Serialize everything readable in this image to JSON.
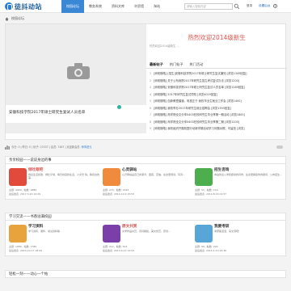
{
  "brand": {
    "name": "徒抖动站",
    "tagline": "www.XXxxxx.com"
  },
  "nav": [
    "校园论坛",
    "教务系统",
    "资料文库",
    "许愿墙",
    "淘站"
  ],
  "search": {
    "placeholder": "请输入搜索内容"
  },
  "header": {
    "login": "登录",
    "settings": "设置后台"
  },
  "breadcrumb": "校园论坛",
  "slide": {
    "caption": "安徽科技学院2017年硕士研究生复试人员名单"
  },
  "welcome": {
    "title": "热烈欢迎2014级新生",
    "subtitle": "热烈欢迎2014级新生 ..."
  },
  "tabs": [
    "最新帖子",
    "热门帖子",
    "热门活动"
  ],
  "posts": [
    "[师苑随笔] [招生]安徽科技学院2017年硕士研究生复试通知 [浏览1349回复]",
    "[师苑随笔] 关于公布我院2017年研究生招生考试复试办法 [浏览1200]",
    "[师苑随笔] 安徽科技学院2017年硕士研究生复试人员名单 [浏览1289回复]",
    "[师苑随笔] 2017年研究生复试须知 [浏览4029回复]",
    "[师苑随笔] 血脉教遵循道，电视正于 我校毕业生就业工作会 [浏览1400]",
    "[师苑随笔] 我校举办2017年研究生就业招聘会 [浏览1393回复]",
    "[师苑随笔] 商学院全文分享0403在校研究生毕业季第一期活动 [浏览1800]",
    "[师苑随笔] 商学院全文分享0403在校研究生毕业季第二期 [浏览1200]",
    "[师苑随笔] 我校组织开展校园行动新学期活动学习问题对照，可留言 [浏览]"
  ],
  "panel_footer": {
    "text": "今日: 0 | 昨日: 0 | 帖子: 23337 | 会员: 7487 | 欢迎新会员:",
    "link": "师事是元"
  },
  "sections": [
    {
      "title": "亲亲校园——说说身边的事",
      "cards": [
        {
          "title": "倾吐眼吧",
          "title_color": "#d9534f",
          "thumb": "#e24a3b",
          "desc": "倾出生活凯歌，倾吐平常，每天校园的生活，人文景 情，聊身边的事...",
          "meta": "主题: 4400，帖数: 4889",
          "meta2": "最后发表: 2017-3-20 10:29"
        },
        {
          "title": "心灵驿站",
          "title_color": "#333",
          "thumb": "#f08a3c",
          "desc": "心灵驿站是自己的港湾，困惑、苦恼，在这里倾诉，写诗...",
          "meta": "主题: 273，帖数: 2424",
          "meta2": "最后发表: 2014-10-9 15:53"
        },
        {
          "title": "招生咨询",
          "title_color": "#333",
          "thumb": "#4cae4c",
          "desc": "本站欢迎入学和报考的同学，在这里解答你的疑问，公布招生...",
          "meta": "主题: 52，帖数: 129",
          "meta2": "最后发表: 2014-8-16 01:57"
        }
      ]
    },
    {
      "title": "学习交流——书香溢满校园",
      "cards": [
        {
          "title": "学习资料",
          "title_color": "#333",
          "thumb": "#e8a33c",
          "desc": "学习资料、课件、考试资料等",
          "meta": "主题: 1089，帖数: 1789",
          "meta2": "最后发表: 2014-10-17 18:09"
        },
        {
          "title": "原文共赏",
          "title_color": "#d9534f",
          "thumb": "#7a3fa8",
          "desc": "文学作品共赏、诗词歌赋、美文欣赏、原创...",
          "meta": "主题: 212，帖数: 614",
          "meta2": "最后发表: 2014-9-12 14:53"
        },
        {
          "title": "我要考研",
          "title_color": "#333",
          "thumb": "#58a6d8",
          "desc": "考研路漫漫，来交流吧！",
          "meta": "主题: 99，帖数: 299",
          "meta2": "最后发表: 2015-1-19 23:36"
        }
      ]
    }
  ],
  "section3": {
    "title": "轻松一刻——动心一个帖"
  }
}
